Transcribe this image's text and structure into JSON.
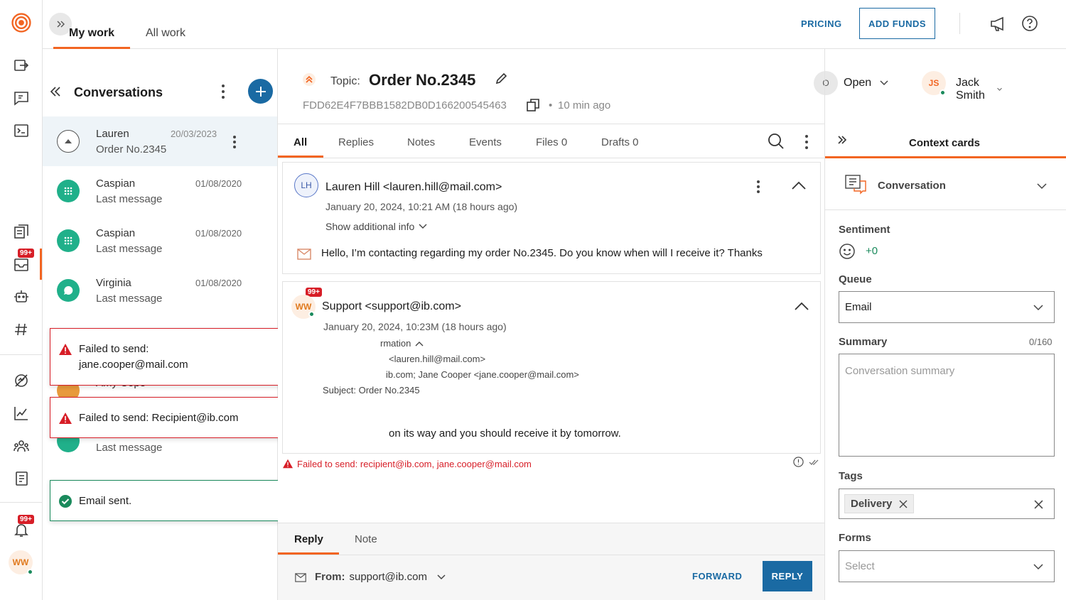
{
  "rail": {
    "nav_badge": "99+",
    "notif_badge": "99+",
    "avatar": "WW"
  },
  "topbar": {
    "tabs": [
      "My work",
      "All work"
    ],
    "pricing": "PRICING",
    "add_funds": "ADD FUNDS"
  },
  "conversations": {
    "title": "Conversations",
    "items": [
      {
        "name": "Lauren",
        "last": "Order No.2345",
        "date": "20/03/2023"
      },
      {
        "name": "Caspian",
        "last": "Last message",
        "date": "01/08/2020"
      },
      {
        "name": "Caspian",
        "last": "Last message",
        "date": "01/08/2020"
      },
      {
        "name": "Virginia",
        "last": "Last message",
        "date": "01/08/2020"
      }
    ],
    "partial_name": "Amy Cope",
    "partial_last": "Last message"
  },
  "toasts": {
    "t1_line1": "Failed to send:",
    "t1_line2": "jane.cooper@mail.com",
    "t2": "Failed to send: Recipient@ib.com",
    "t3": "Email sent."
  },
  "header": {
    "topic_label": "Topic:",
    "topic": "Order No.2345",
    "id": "FDD62E4F7BBB1582DB0D166200545463",
    "age": "10 min ago",
    "status": "Open",
    "status_initial": "O",
    "assignee": "Jack Smith",
    "assignee_initials": "JS"
  },
  "tabs": [
    "All",
    "Replies",
    "Notes",
    "Events",
    "Files 0",
    "Drafts 0"
  ],
  "message1": {
    "initials": "LH",
    "from": "Lauren Hill <lauren.hill@mail.com>",
    "date": "January 20, 2024, 10:21 AM (18 hours ago)",
    "show_info": "Show additional info",
    "body": "Hello, I’m contacting regarding my order No.2345. Do you know when will I receive it? Thanks"
  },
  "message2": {
    "badge": "99+",
    "initials": "WW",
    "from": "Support <support@ib.com>",
    "date": "January 20, 2024, 10:23M (18 hours ago)",
    "info": "rmation",
    "to": "<lauren.hill@mail.com>",
    "cc": "ib.com;  Jane Cooper <jane.cooper@mail.com>",
    "subject": "Subject: Order No.2345",
    "body": "on its way and you should receive it by tomorrow."
  },
  "error_line": "Failed to send: recipient@ib.com, jane.cooper@mail.com",
  "composer": {
    "tabs": [
      "Reply",
      "Note"
    ],
    "from_label": "From:",
    "from_value": "support@ib.com",
    "forward": "FORWARD",
    "reply": "REPLY"
  },
  "context": {
    "title": "Context cards",
    "section": "Conversation",
    "sentiment_label": "Sentiment",
    "sentiment_value": "+0",
    "queue_label": "Queue",
    "queue_value": "Email",
    "summary_label": "Summary",
    "summary_count": "0/160",
    "summary_placeholder": "Conversation summary",
    "tags_label": "Tags",
    "tag": "Delivery",
    "forms_label": "Forms",
    "forms_placeholder": "Select"
  },
  "colors": {
    "brand": "#f26522",
    "link": "#1a6aa3",
    "error": "#d71e27",
    "success": "#1a8a5c",
    "teal": "#20b08a",
    "selected_bg": "#eef4f8"
  }
}
